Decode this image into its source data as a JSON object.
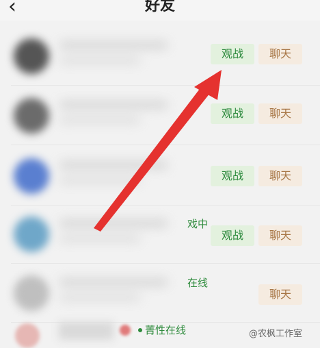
{
  "header": {
    "back_icon": "chevron-left-icon",
    "back_glyph": "‹",
    "title": "好友"
  },
  "friends": [
    {
      "status": "",
      "buttons": {
        "watch": "观战",
        "chat": "聊天"
      }
    },
    {
      "status": "",
      "buttons": {
        "watch": "观战",
        "chat": "聊天"
      }
    },
    {
      "status": "",
      "buttons": {
        "watch": "观战",
        "chat": "聊天"
      }
    },
    {
      "status": "戏中",
      "buttons": {
        "watch": "观战",
        "chat": "聊天"
      }
    },
    {
      "status": "在线",
      "buttons": {
        "watch": "",
        "chat": "聊天"
      }
    }
  ],
  "bottom_row": {
    "status": "菁性在线"
  },
  "watermark": "@农枫工作室",
  "colors": {
    "watch_bg": "#e3f1de",
    "watch_text": "#2f8b3f",
    "chat_bg": "#f5ebe0",
    "chat_text": "#a77645",
    "arrow": "#e5322f"
  }
}
